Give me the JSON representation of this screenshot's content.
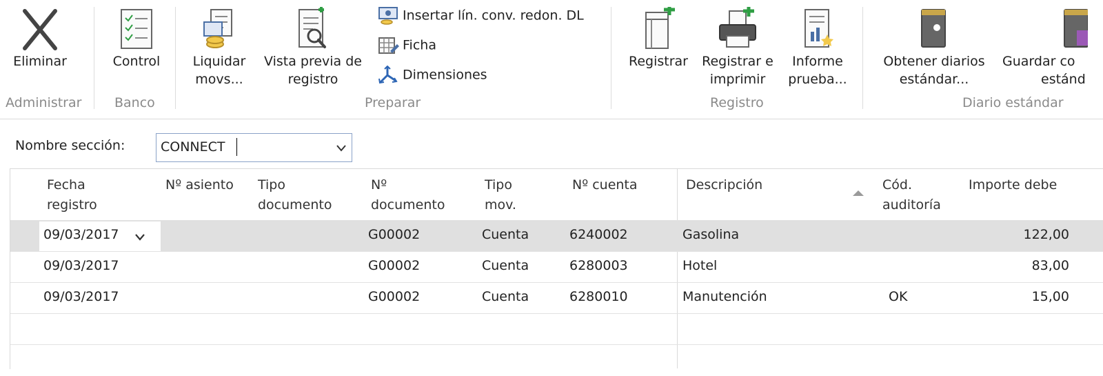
{
  "ribbon": {
    "groups": {
      "administrar": {
        "label": "Administrar",
        "delete_label": "Eliminar"
      },
      "banco": {
        "label": "Banco",
        "control_label": "Control"
      },
      "preparar": {
        "label": "Preparar",
        "liquidar_line1": "Liquidar",
        "liquidar_line2": "movs...",
        "vista_line1": "Vista previa de",
        "vista_line2": "registro",
        "insertar_label": "Insertar lín. conv. redon. DL",
        "ficha_label": "Ficha",
        "dimensiones_label": "Dimensiones"
      },
      "registro": {
        "label": "Registro",
        "registrar_label": "Registrar",
        "registrar_imprimir_line1": "Registrar e",
        "registrar_imprimir_line2": "imprimir",
        "informe_line1": "Informe",
        "informe_line2": "prueba..."
      },
      "diario": {
        "label": "Diario estándar",
        "obtener_line1": "Obtener diarios",
        "obtener_line2": "estándar...",
        "guardar_line1": "Guardar co",
        "guardar_line2": "estánd"
      }
    }
  },
  "filter": {
    "label": "Nombre sección:",
    "value": "CONNECT"
  },
  "grid": {
    "headers": {
      "fecha_1": "Fecha",
      "fecha_2": "registro",
      "asiento": "Nº asiento",
      "tipodoc_1": "Tipo",
      "tipodoc_2": "documento",
      "ndoc_1": "Nº",
      "ndoc_2": "documento",
      "tipomov_1": "Tipo",
      "tipomov_2": "mov.",
      "ncuenta": "Nº cuenta",
      "descripcion": "Descripción",
      "auditoria_1": "Cód.",
      "auditoria_2": "auditoría",
      "importe": "Importe debe"
    },
    "rows": [
      {
        "fecha": "09/03/2017",
        "ndoc": "G00002",
        "tipomov": "Cuenta",
        "ncuenta": "6240002",
        "descripcion": "Gasolina",
        "auditoria": "",
        "importe": "122,00"
      },
      {
        "fecha": "09/03/2017",
        "ndoc": "G00002",
        "tipomov": "Cuenta",
        "ncuenta": "6280003",
        "descripcion": "Hotel",
        "auditoria": "",
        "importe": "83,00"
      },
      {
        "fecha": "09/03/2017",
        "ndoc": "G00002",
        "tipomov": "Cuenta",
        "ncuenta": "6280010",
        "descripcion": "Manutención",
        "auditoria": "OK",
        "importe": "15,00"
      }
    ]
  }
}
